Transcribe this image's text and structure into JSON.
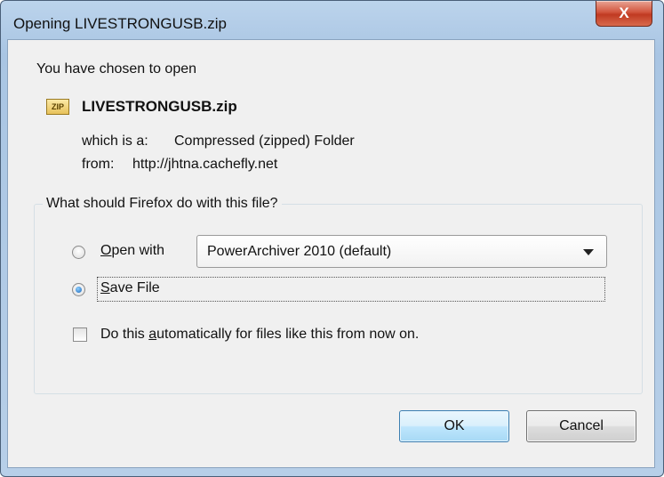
{
  "window": {
    "title": "Opening LIVESTRONGUSB.zip",
    "close_label": "X"
  },
  "intro": "You have chosen to open",
  "file": {
    "icon_text": "ZIP",
    "name": "LIVESTRONGUSB.zip",
    "type_label": "which is a:",
    "type_value": "Compressed (zipped) Folder",
    "from_label": "from:",
    "from_value": "http://jhtna.cachefly.net"
  },
  "action_group": {
    "label": "What should Firefox do with this file?",
    "open_with": {
      "mnemonic": "O",
      "rest": "pen with",
      "checked": false,
      "selected_app": "PowerArchiver 2010 (default)"
    },
    "save_file": {
      "mnemonic": "S",
      "rest": "ave File",
      "checked": true
    },
    "auto": {
      "before": "Do this ",
      "mnemonic": "a",
      "after": "utomatically for files like this from now on.",
      "checked": false
    }
  },
  "buttons": {
    "ok": "OK",
    "cancel": "Cancel"
  },
  "colors": {
    "title_bar": "#a9c5e3",
    "close_button": "#c03a22",
    "ok_border": "#3c7fb1"
  },
  "icons": [
    "zip-file-icon",
    "close-icon",
    "dropdown-arrow-icon"
  ]
}
